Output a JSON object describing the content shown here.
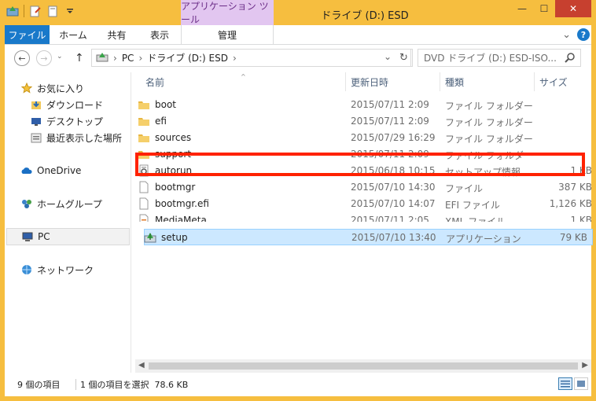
{
  "window": {
    "title": "ドライブ (D:) ESD",
    "context_tab": "アプリケーション ツール",
    "minimize": "—",
    "maximize": "☐",
    "close": "✕"
  },
  "ribbon": {
    "tabs": [
      "ファイル",
      "ホーム",
      "共有",
      "表示",
      "管理"
    ],
    "collapse_glyph": "⌄",
    "help_label": "?"
  },
  "address": {
    "back_glyph": "←",
    "forward_glyph": "→",
    "up_glyph": "↑",
    "path": [
      "PC",
      "ドライブ (D:) ESD"
    ],
    "separator": "›",
    "dropdown_glyph": "⌄",
    "refresh_glyph": "↻",
    "search_placeholder": "DVD ドライブ (D:) ESD-ISO..."
  },
  "nav": {
    "items": [
      {
        "label": "お気に入り",
        "icon": "star-icon"
      },
      {
        "label": "ダウンロード",
        "icon": "downloads-icon"
      },
      {
        "label": "デスクトップ",
        "icon": "desktop-icon"
      },
      {
        "label": "最近表示した場所",
        "icon": "recent-places-icon"
      },
      {
        "label": "OneDrive",
        "icon": "cloud-icon"
      },
      {
        "label": "ホームグループ",
        "icon": "homegroup-icon"
      },
      {
        "label": "PC",
        "icon": "pc-icon"
      },
      {
        "label": "ネットワーク",
        "icon": "network-icon"
      }
    ]
  },
  "columns": {
    "name": "名前",
    "date": "更新日時",
    "type": "種類",
    "size": "サイズ"
  },
  "files": [
    {
      "name": "boot",
      "date": "2015/07/11 2:09",
      "type": "ファイル フォルダー",
      "size": "",
      "icon": "folder-icon"
    },
    {
      "name": "efi",
      "date": "2015/07/11 2:09",
      "type": "ファイル フォルダー",
      "size": "",
      "icon": "folder-icon"
    },
    {
      "name": "sources",
      "date": "2015/07/29 16:29",
      "type": "ファイル フォルダー",
      "size": "",
      "icon": "folder-icon"
    },
    {
      "name": "support",
      "date": "2015/07/11 2:09",
      "type": "ファイル フォルダー",
      "size": "",
      "icon": "folder-icon"
    },
    {
      "name": "autorun",
      "date": "2015/06/18 10:15",
      "type": "セットアップ情報",
      "size": "1 KB",
      "icon": "setup-info-icon"
    },
    {
      "name": "bootmgr",
      "date": "2015/07/10 14:30",
      "type": "ファイル",
      "size": "387 KB",
      "icon": "file-icon"
    },
    {
      "name": "bootmgr.efi",
      "date": "2015/07/10 14:07",
      "type": "EFI ファイル",
      "size": "1,126 KB",
      "icon": "file-icon"
    },
    {
      "name": "MediaMeta",
      "date": "2015/07/11 2:05",
      "type": "XML ファイル",
      "size": "1 KB",
      "icon": "xml-file-icon"
    },
    {
      "name": "setup",
      "date": "2015/07/10 13:40",
      "type": "アプリケーション",
      "size": "79 KB",
      "icon": "setup-app-icon"
    }
  ],
  "status": {
    "item_count": "9 個の項目",
    "selection": "1 個の項目を選択  78.6 KB"
  },
  "colors": {
    "frame": "#f6be3f",
    "file_tab": "#1979ca",
    "context_tab": "#e2c6f0",
    "selection": "#cce8ff",
    "highlight_box": "#ff2200",
    "close_button": "#c7402f"
  }
}
